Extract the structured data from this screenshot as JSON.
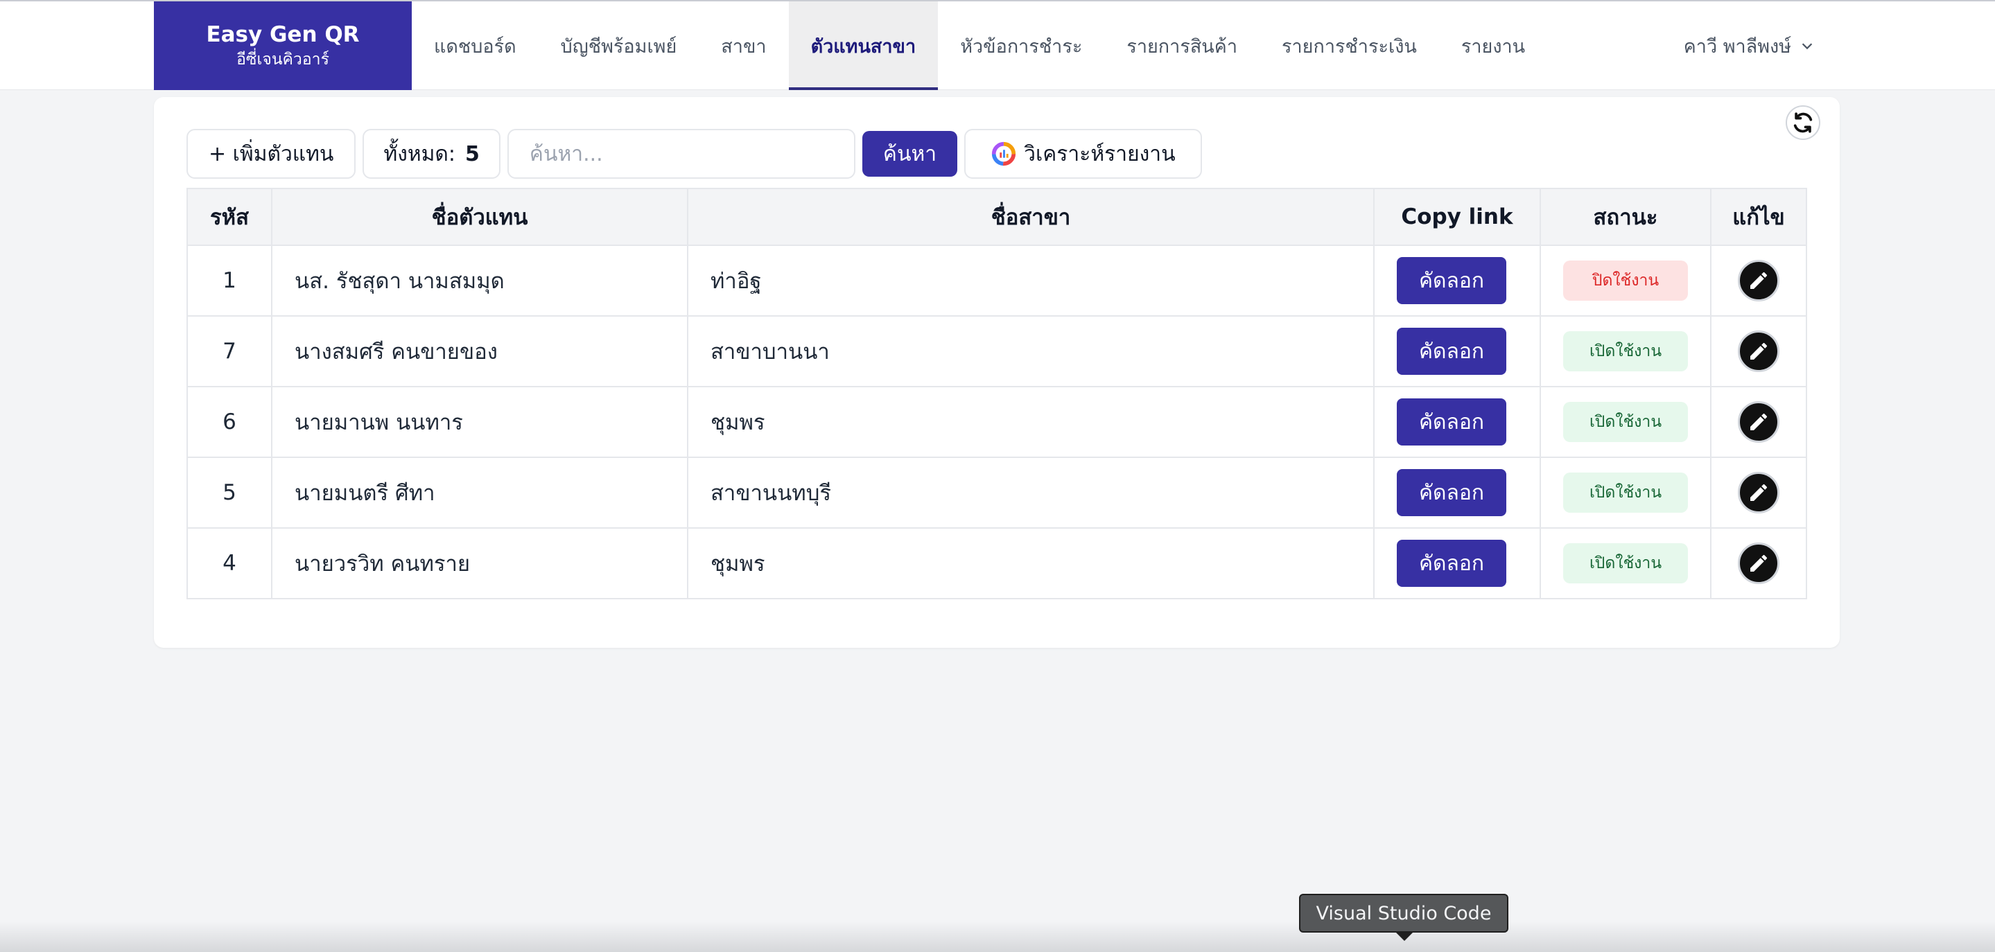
{
  "brand": {
    "title": "Easy Gen QR",
    "subtitle": "อีซี่เจนคิวอาร์"
  },
  "nav": [
    {
      "label": "แดชบอร์ด"
    },
    {
      "label": "บัญชีพร้อมเพย์"
    },
    {
      "label": "สาขา"
    },
    {
      "label": "ตัวแทนสาขา",
      "active": true
    },
    {
      "label": "หัวข้อการชำระ"
    },
    {
      "label": "รายการสินค้า"
    },
    {
      "label": "รายการชำระเงิน"
    },
    {
      "label": "รายงาน"
    }
  ],
  "user": {
    "name": "คาวี พาลีพงษ์"
  },
  "toolbar": {
    "add_label": "+ เพิ่มตัวแทน",
    "total_label": "ทั้งหมด:",
    "total_value": "5",
    "search_placeholder": "ค้นหา...",
    "search_button": "ค้นหา",
    "analyze_label": "วิเคราะห์รายงาน"
  },
  "table": {
    "headers": {
      "id": "รหัส",
      "name": "ชื่อตัวแทน",
      "branch": "ชื่อสาขา",
      "copy": "Copy link",
      "status": "สถานะ",
      "edit": "แก้ไข"
    },
    "copy_label": "คัดลอก",
    "rows": [
      {
        "id": "1",
        "name": "นส. รัชสุดา นามสมมุด",
        "branch": "ท่าอิฐ",
        "status": "ปิดใช้งาน",
        "status_type": "off"
      },
      {
        "id": "7",
        "name": "นางสมศรี คนขายของ",
        "branch": "สาขาบานนา",
        "status": "เปิดใช้งาน",
        "status_type": "on"
      },
      {
        "id": "6",
        "name": "นายมานพ นนทาร",
        "branch": "ชุมพร",
        "status": "เปิดใช้งาน",
        "status_type": "on"
      },
      {
        "id": "5",
        "name": "นายมนตรี ศีทา",
        "branch": "สาขานนทบุรี",
        "status": "เปิดใช้งาน",
        "status_type": "on"
      },
      {
        "id": "4",
        "name": "นายวรวิท คนทราย",
        "branch": "ชุมพร",
        "status": "เปิดใช้งาน",
        "status_type": "on"
      }
    ]
  },
  "tooltip": {
    "text": "Visual Studio Code"
  },
  "colors": {
    "primary": "#3730a3",
    "status_off_bg": "#fde2e2",
    "status_off_text": "#dc2626",
    "status_on_bg": "#e6f8ec",
    "status_on_text": "#166534"
  },
  "icons": {
    "refresh": "refresh-icon",
    "edit": "pencil-icon",
    "analyze": "chart-ring-icon",
    "user_menu": "chevron-down-icon"
  }
}
